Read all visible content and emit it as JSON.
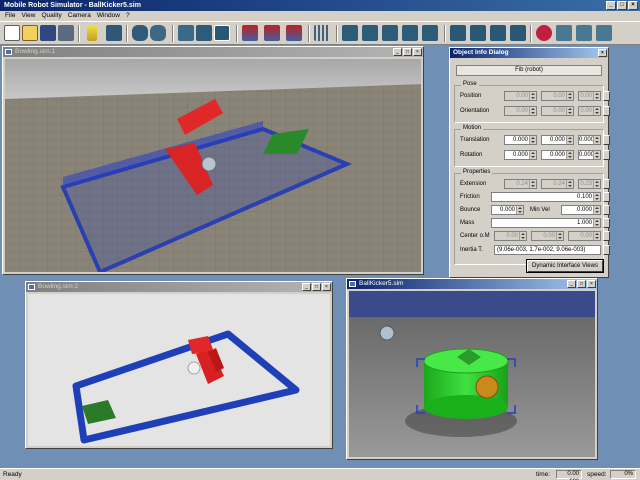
{
  "app": {
    "title": "Mobile Robot Simulator - BallKicker5.sim",
    "minimize": "_",
    "maximize": "□",
    "close": "×"
  },
  "menu": [
    "File",
    "View",
    "Quality",
    "Camera",
    "Window",
    "?"
  ],
  "windows": {
    "bowling1": {
      "title": "Bowling.sim:1"
    },
    "bowling2": {
      "title": "Bowling.sim:2"
    },
    "ballkicker": {
      "title": "BallKicker5.sim"
    }
  },
  "dialog": {
    "title": "Object Info Dialog",
    "object": "Fib (robot)",
    "pose": {
      "title": "Pose",
      "position_label": "Position",
      "position": [
        "0.00",
        "0.00",
        "0.00"
      ],
      "orientation_label": "Orientation",
      "orientation": [
        "0.00",
        "0.00",
        "0.00"
      ]
    },
    "motion": {
      "title": "Motion",
      "translation_label": "Translation",
      "translation": [
        "0.000",
        "0.000",
        "0.000"
      ],
      "rotation_label": "Rotation",
      "rotation": [
        "0.000",
        "0.000",
        "0.000"
      ]
    },
    "properties": {
      "title": "Properties",
      "extension_label": "Extension",
      "extension": [
        "0.24",
        "0.24",
        "0.23"
      ],
      "friction_label": "Friction",
      "friction": "0.100",
      "bounce_label": "Bounce",
      "bounce": "0.000",
      "min_vel_label": "Min Vel",
      "min_vel": "0.000",
      "mass_label": "Mass",
      "mass": "1.000",
      "center_label": "Center o.M",
      "center": [
        "0.00",
        "0.00",
        "0.00"
      ],
      "inertia_label": "Inertia T.",
      "inertia": "(9.06e-003, 1.7e-002, 9.06e-003)"
    },
    "dynamic_button": "Dynamic Interface Views"
  },
  "status": {
    "text": "Ready",
    "time_label": "time:",
    "time": "0.00 sec",
    "speed_label": "speed:",
    "speed": "0%"
  },
  "colors": {
    "desktop": "#6f8fb4",
    "chrome": "#d4d0c8",
    "title_active": "#0a246a",
    "wall_blue": "#1f3fb8",
    "pin_red": "#e02828",
    "pad_green": "#2a8a2a",
    "robot_green": "#28c828"
  },
  "toolbar_icons": [
    "new-icon",
    "open-icon",
    "save-icon",
    "print-icon",
    "info-icon",
    "list-icon",
    "robot-arm-icon",
    "robot-arm-2-icon",
    "cube-icon",
    "cube-2-icon",
    "cube-3-icon",
    "joint-icon",
    "joint-2-icon",
    "joint-3-icon",
    "grid-icon",
    "cube-4-icon",
    "cube-5-icon",
    "cube-6-icon",
    "cube-7-icon",
    "cube-8-icon",
    "arrow-icon",
    "skip-icon",
    "play-icon",
    "fast-forward-icon",
    "record-icon",
    "reset-icon",
    "floppy-icon",
    "undo-icon"
  ]
}
